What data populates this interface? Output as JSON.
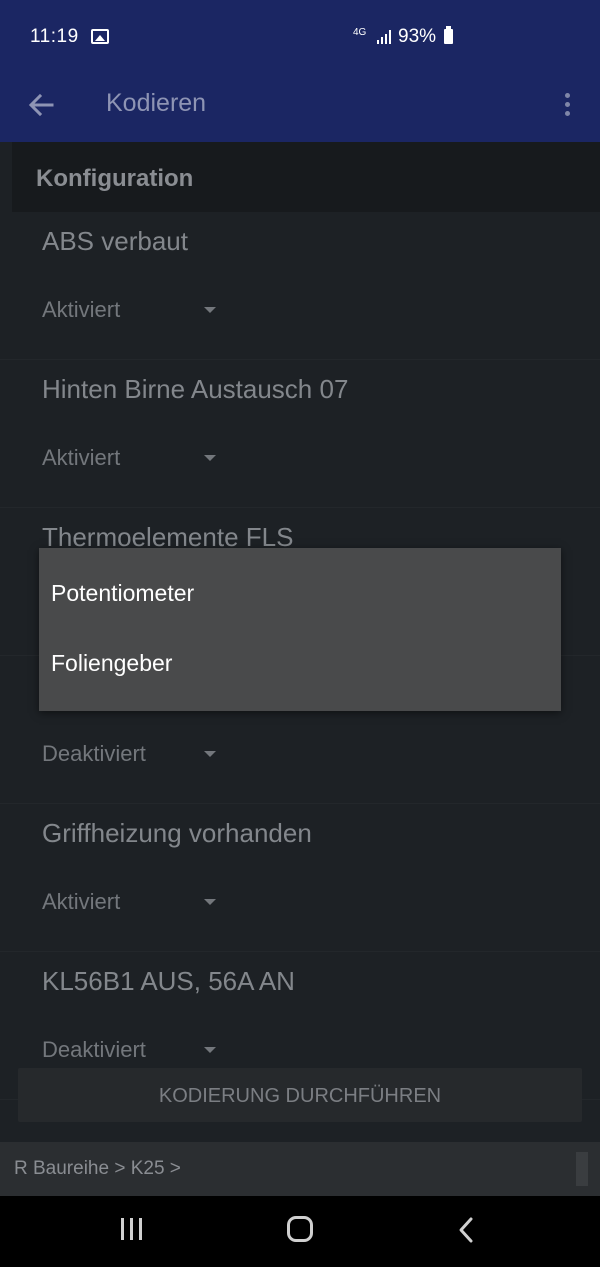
{
  "status_bar": {
    "time": "11:19",
    "net_label": "4G",
    "battery": "93%",
    "icons": [
      "gallery-icon",
      "network-icon",
      "signal-icon",
      "battery-icon"
    ]
  },
  "app_bar": {
    "title": "Kodieren",
    "back_icon": "arrow-left-icon",
    "menu_icon": "more-vert-icon"
  },
  "section": {
    "title": "Konfiguration"
  },
  "config_items": [
    {
      "label": "ABS verbaut",
      "value": "Aktiviert"
    },
    {
      "label": "Hinten Birne Austausch 07",
      "value": "Aktiviert"
    },
    {
      "label": "Thermoelemente FLS",
      "value": ""
    },
    {
      "label": "",
      "value": "Deaktiviert"
    },
    {
      "label": "Griffheizung vorhanden",
      "value": "Aktiviert"
    },
    {
      "label": "KL56B1 AUS, 56A AN",
      "value": "Deaktiviert"
    }
  ],
  "dropdown": {
    "options": [
      "Potentiometer",
      "Foliengeber"
    ]
  },
  "action_button": {
    "label": "KODIERUNG DURCHFÜHREN"
  },
  "breadcrumb": {
    "path": "R Baureihe > K25 >"
  },
  "colors": {
    "app_bar": "#1b2663",
    "background": "#1d2125",
    "dropdown": "#494a4b"
  }
}
